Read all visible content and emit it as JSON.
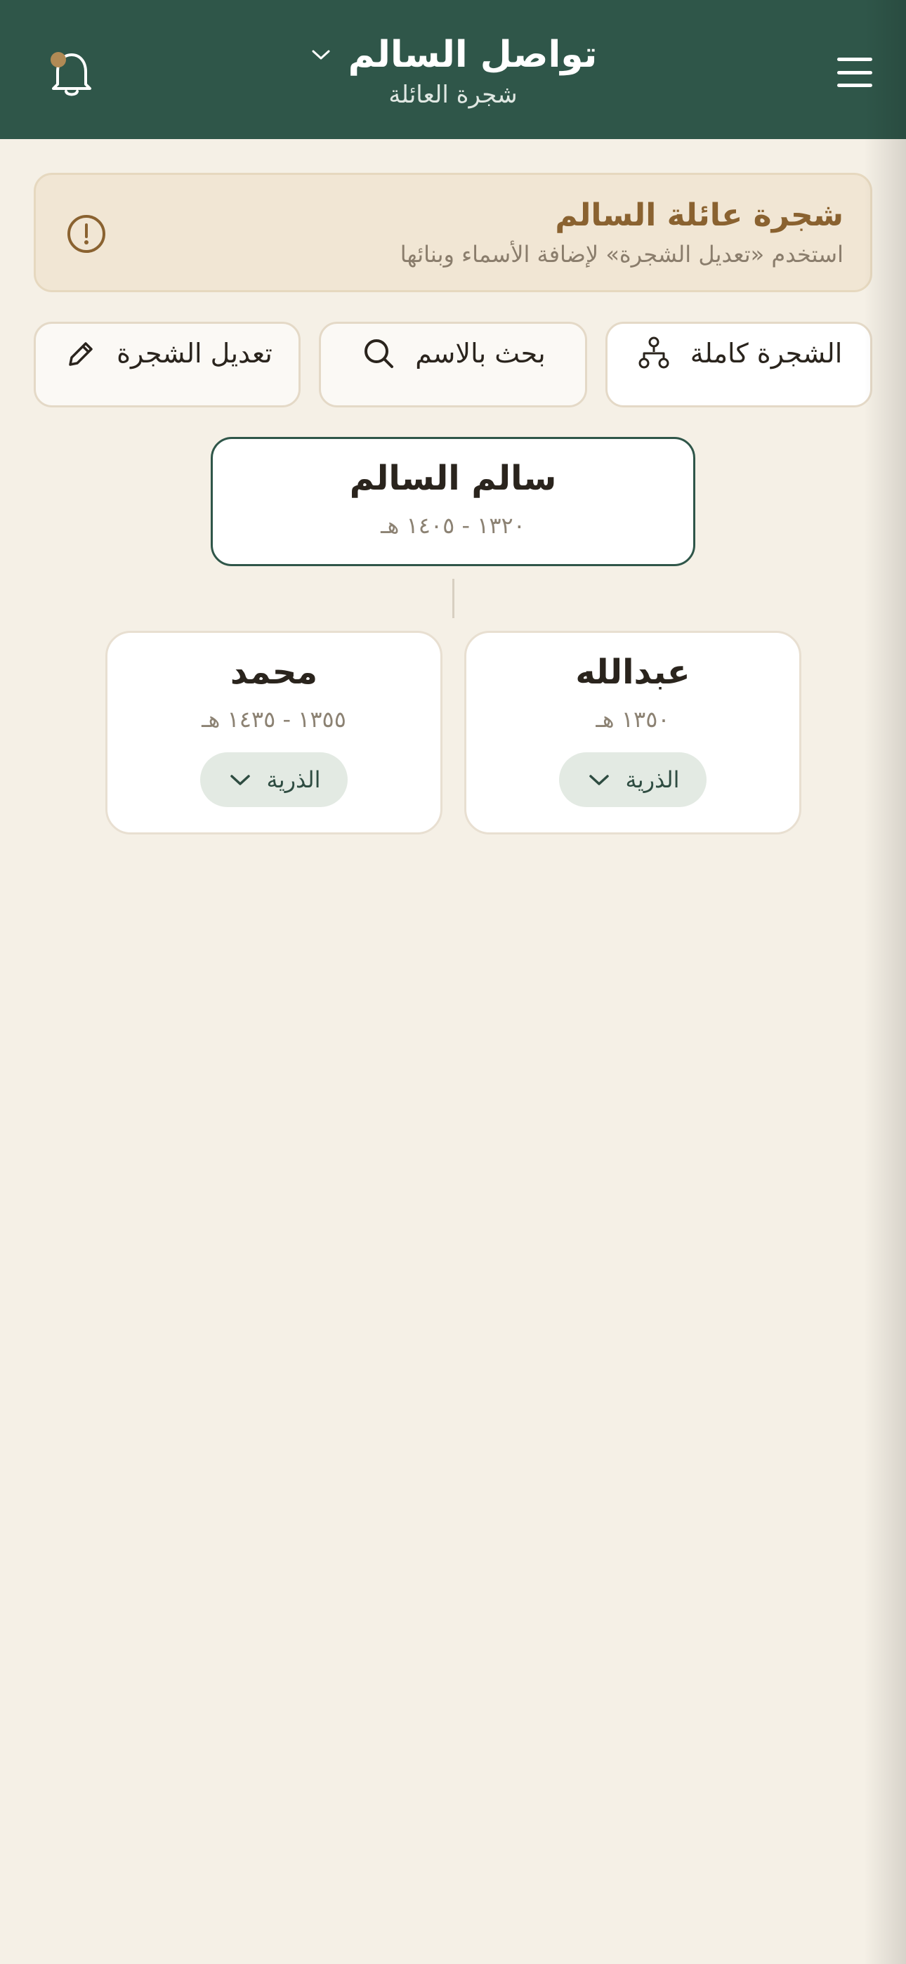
{
  "header": {
    "title": "تواصل السالم",
    "subtitle": "شجرة العائلة",
    "accent": "#2f5649",
    "notification_dot_color": "#b08a55",
    "icons": {
      "menu": "hamburger-icon",
      "notifications": "bell-icon",
      "title_dropdown": "chevron-down-icon"
    }
  },
  "banner": {
    "title": "شجرة عائلة السالم",
    "text": "استخدم «تعديل الشجرة» لإضافة الأسماء وبنائها",
    "icon": "info-alert-icon"
  },
  "actions": {
    "full_tree": {
      "label": "الشجرة كاملة",
      "icon": "tree-structure-icon"
    },
    "search": {
      "label": "بحث بالاسم",
      "icon": "search-icon"
    },
    "edit": {
      "label": "تعديل الشجرة",
      "icon": "pencil-icon"
    }
  },
  "tree": {
    "root": {
      "name": "سالم السالم",
      "dates": "١٣٢٠ - ١٤٠٥ هـ"
    },
    "children": [
      {
        "name": "عبدالله",
        "dates": "١٣٥٠ هـ",
        "descendants_label": "الذرية"
      },
      {
        "name": "محمد",
        "dates": "١٣٥٥ - ١٤٣٥ هـ",
        "descendants_label": "الذرية"
      }
    ]
  }
}
